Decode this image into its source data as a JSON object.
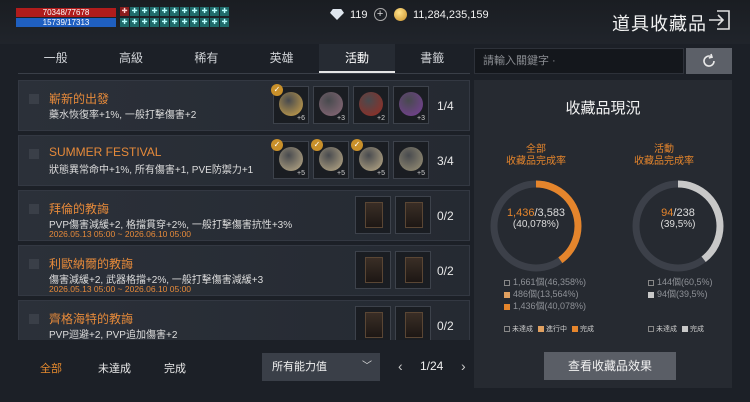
{
  "player": {
    "hp": "70348/77678",
    "mp": "15739/17313"
  },
  "buffs": [
    "✚",
    "✚",
    "✚",
    "✚",
    "✚",
    "✚",
    "✚",
    "✚",
    "✚",
    "✚",
    "✚",
    "✚",
    "✚",
    "✚",
    "✚",
    "✚",
    "✚",
    "✚",
    "✚",
    "✚",
    "✚",
    "✚"
  ],
  "currency": {
    "diamonds": "119",
    "gold": "11,284,235,159"
  },
  "header": {
    "title": "道具收藏品"
  },
  "tabs": [
    {
      "label": "一般"
    },
    {
      "label": "高級"
    },
    {
      "label": "稀有"
    },
    {
      "label": "英雄"
    },
    {
      "label": "活動"
    },
    {
      "label": "書籤"
    }
  ],
  "search": {
    "placeholder": "請輸入關鍵字 ·"
  },
  "collections": [
    {
      "title": "嶄新的出發",
      "desc": "藥水恢復率+1%, 一般打擊傷害+2",
      "date": "",
      "count": "1/4",
      "items": [
        {
          "num": "+6",
          "checked": true,
          "color": "#d1a64a"
        },
        {
          "num": "+3",
          "checked": false,
          "color": "#8d6a7a"
        },
        {
          "num": "+2",
          "checked": false,
          "color": "#9b2a20"
        },
        {
          "num": "+3",
          "checked": false,
          "color": "#7a3f9a"
        }
      ]
    },
    {
      "title": "SUMMER FESTIVAL",
      "desc": "狀態異常命中+1%, 所有傷害+1, PVE防禦力+1",
      "date": "",
      "count": "3/4",
      "items": [
        {
          "num": "+5",
          "checked": true,
          "color": "#bfae8a"
        },
        {
          "num": "+5",
          "checked": true,
          "color": "#bfae8a"
        },
        {
          "num": "+5",
          "checked": true,
          "color": "#bfae8a"
        },
        {
          "num": "+5",
          "checked": false,
          "color": "#9d9478"
        }
      ]
    },
    {
      "title": "拜倫的教誨",
      "desc": "PVP傷害減緩+2, 格擋貫穿+2%, 一般打擊傷害抗性+3%",
      "date": "2026.05.13 05:00 ~ 2026.06.10 05:00",
      "count": "0/2",
      "cards": 2
    },
    {
      "title": "利歐納爾的教誨",
      "desc": "傷害減緩+2, 武器格擋+2%, 一般打擊傷害減緩+3",
      "date": "2026.05.13 05:00 ~ 2026.06.10 05:00",
      "count": "0/2",
      "cards": 2
    },
    {
      "title": "齊格海特的教誨",
      "desc": "PVP迴避+2, PVP追加傷害+2",
      "date": "2026.05.13 05:00 ~ 2026.06.10 05:00",
      "count": "0/2",
      "cards": 2
    }
  ],
  "filters": [
    {
      "label": "全部"
    },
    {
      "label": "未達成"
    },
    {
      "label": "完成"
    }
  ],
  "dropdown": {
    "value": "所有能力值"
  },
  "pager": {
    "text": "1/24",
    "prev": "‹",
    "next": "›"
  },
  "panel": {
    "title": "收藏品現況",
    "all": {
      "heading": "全部",
      "subheading": "收藏品完成率",
      "value": "1,436",
      "total": "/3,583",
      "percent": "(40,078%)",
      "fraction": 0.4008,
      "legend": [
        "1,661個(46,358%)",
        "486個(13,564%)",
        "1,436個(40,078%)"
      ]
    },
    "event": {
      "heading": "活動",
      "subheading": "收藏品完成率",
      "value": "94",
      "total": "/238",
      "percent": "(39,5%)",
      "fraction": 0.395,
      "legend": [
        "144個(60,5%)",
        "94個(39,5%)"
      ]
    },
    "keys": {
      "incomplete": "未達成",
      "inprogress": "進行中",
      "complete": "完成"
    },
    "button": "查看收藏品效果"
  },
  "colors": {
    "accent": "#e5852c",
    "complete_event": "#c8c8c8"
  }
}
